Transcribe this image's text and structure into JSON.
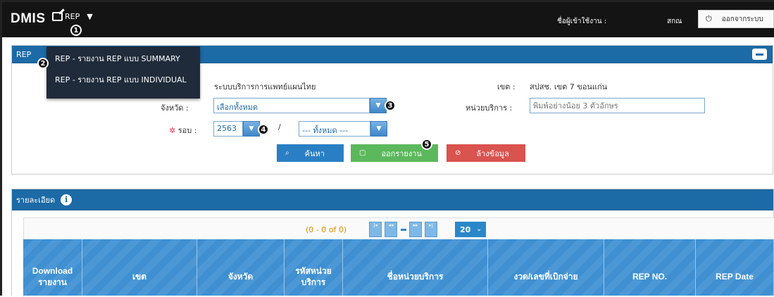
{
  "app": {
    "brand": "DMIS"
  },
  "topbar": {
    "menu_label": "REP",
    "menu_caret": "▼",
    "user_label": "ชื่อผู้เข้าใช้งาน :",
    "user_name": "สกณ",
    "logout_icon": "⏻",
    "logout_label": "ออกจากระบบ"
  },
  "dropdown": {
    "items": [
      {
        "label": "REP - รายงาน REP แบบ SUMMARY"
      },
      {
        "label": "REP - รายงาน REP แบบ INDIVIDUAL"
      }
    ]
  },
  "search_panel": {
    "title": "REP",
    "service_system": "ระบบบริการการแพทย์แผนไทย",
    "zone_label": "เขต :",
    "zone_value": "สปสช. เขต 7 ขอนแก่น",
    "province_label": "จังหวัด :",
    "province_value": "เลือกทั้งหมด",
    "unit_label": "หน่วยบริการ :",
    "unit_placeholder": "พิมพ์อย่างน้อย 3 ตัวอักษร",
    "round_required_mark": "✲",
    "round_label": "รอบ :",
    "round_year": "2563",
    "round_sep": "/",
    "round_period": "--- ทั้งหมด ---",
    "search_button": "ค้นหา",
    "report_button": "ออกรายงาน",
    "clear_button": "ล้างข้อมูล"
  },
  "badges": [
    "1",
    "2",
    "3",
    "4",
    "5"
  ],
  "detail_panel": {
    "title": "รายละเอียด",
    "info_icon": "i",
    "pager_text": "(0 - 0 of 0)",
    "page_size": "20",
    "columns": [
      "Download รายงาน",
      "เขต",
      "จังหวัด",
      "รหัสหน่วย บริการ",
      "ชื่อหน่วยบริการ",
      "งวด/เลขที่เบิกจ่าย",
      "REP NO.",
      "REP Date"
    ]
  },
  "colors": {
    "topbar": "#141414",
    "panel_header": "#1c6aa6",
    "search_button": "#2a7fc4",
    "report_button": "#5cb85c",
    "clear_button": "#d9534f",
    "table_header": "#4593d3"
  }
}
